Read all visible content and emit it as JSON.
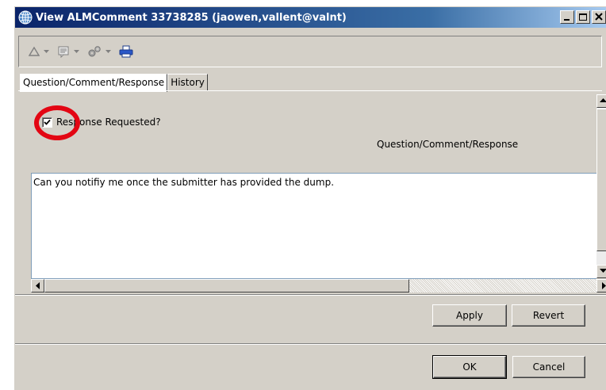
{
  "window": {
    "title": "View ALMComment 33738285 (jaowen,vallent@valnt)"
  },
  "toolbar": {
    "items": [
      {
        "name": "delta-icon"
      },
      {
        "name": "comment-icon"
      },
      {
        "name": "gears-icon"
      },
      {
        "name": "printer-icon"
      }
    ]
  },
  "tabs": [
    {
      "label": "Question/Comment/Response",
      "active": true
    },
    {
      "label": "History",
      "active": false
    }
  ],
  "form": {
    "response_requested_label": "Response Requested?",
    "response_requested_checked": true,
    "field_label": "Question/Comment/Response",
    "comment_text": "Can you notifiy me once the submitter has provided the dump."
  },
  "buttons": {
    "apply": "Apply",
    "revert": "Revert",
    "ok": "OK",
    "cancel": "Cancel"
  },
  "colors": {
    "annotation_ring": "#e30613",
    "title_gradient_start": "#0a246a",
    "window_face": "#d4d0c8"
  }
}
